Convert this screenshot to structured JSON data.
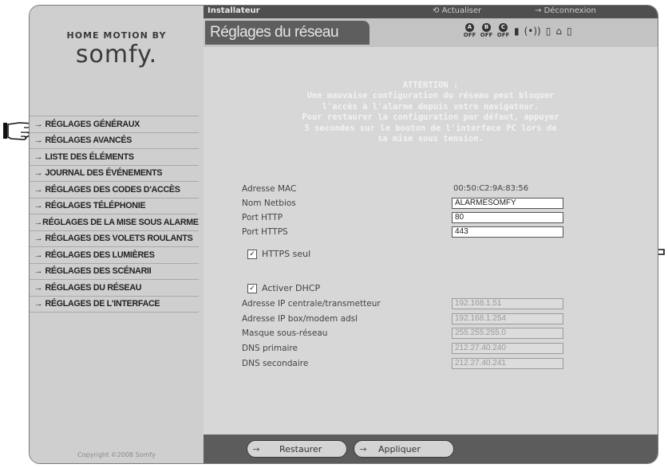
{
  "brand": {
    "line1": "HOME MOTION BY",
    "logo": "somfy."
  },
  "topbar": {
    "role": "Installateur",
    "refresh": "Actualiser",
    "logout": "Déconnexion"
  },
  "header": {
    "title": "Réglages du réseau",
    "zones": [
      {
        "letter": "A",
        "state": "OFF"
      },
      {
        "letter": "B",
        "state": "OFF"
      },
      {
        "letter": "C",
        "state": "OFF"
      }
    ],
    "status_icons": [
      "battery-icon",
      "radio-signal-icon",
      "door-icon",
      "home-icon",
      "plug-icon"
    ]
  },
  "sidebar": {
    "items": [
      {
        "label": "RÉGLAGES GÉNÉRAUX"
      },
      {
        "label": "RÉGLAGES AVANCÉS"
      },
      {
        "label": "LISTE DES ÉLÉMENTS"
      },
      {
        "label": "JOURNAL DES ÉVÉNEMENTS"
      },
      {
        "label": "RÉGLAGES DES CODES D'ACCÈS"
      },
      {
        "label": "RÉGLAGES TÉLÉPHONIE"
      },
      {
        "label": "RÉGLAGES DE LA MISE SOUS ALARME"
      },
      {
        "label": "RÉGLAGES DES VOLETS ROULANTS"
      },
      {
        "label": "RÉGLAGES DES LUMIÈRES"
      },
      {
        "label": "RÉGLAGES DES SCÉNARII"
      },
      {
        "label": "RÉGLAGES DU RÉSEAU"
      },
      {
        "label": "RÉGLAGES DE L'INTERFACE"
      }
    ],
    "copyright": "Copyright ©2008 Somfy"
  },
  "warning": {
    "title": "ATTENTION :",
    "lines": [
      "Une mauvaise configuration du réseau peut bloquer",
      "l'accès à l'alarme depuis votre navigateur.",
      "Pour restaurer la configuration par défaut, appuyer",
      "5 secondes sur le bouton de l'interface PC lors de",
      "sa mise sous tension."
    ]
  },
  "form": {
    "mac": {
      "label": "Adresse MAC",
      "value": "00:50:C2:9A:83:56"
    },
    "netbios": {
      "label": "Nom Netbios",
      "value": "ALARMESOMFY"
    },
    "http": {
      "label": "Port HTTP",
      "value": "80"
    },
    "https": {
      "label": "Port HTTPS",
      "value": "443"
    },
    "https_only": {
      "label": "HTTPS seul",
      "checked": true
    },
    "dhcp": {
      "label": "Activer DHCP",
      "checked": true
    },
    "ip_central": {
      "label": "Adresse IP centrale/transmetteur",
      "value": "192.168.1.51"
    },
    "ip_box": {
      "label": "Adresse IP box/modem adsl",
      "value": "192.168.1.254"
    },
    "mask": {
      "label": "Masque sous-réseau",
      "value": "255.255.255.0"
    },
    "dns1": {
      "label": "DNS primaire",
      "value": "212.27.40.240"
    },
    "dns2": {
      "label": "DNS secondaire",
      "value": "212.27.40.241"
    }
  },
  "footer": {
    "restore": "Restaurer",
    "apply": "Appliquer"
  }
}
